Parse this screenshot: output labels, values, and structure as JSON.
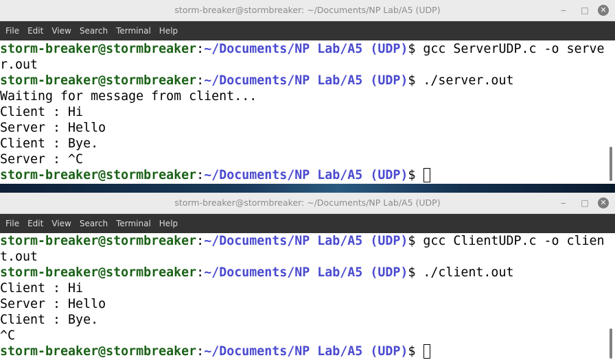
{
  "windows": [
    {
      "title": "storm-breaker@stormbreaker: ~/Documents/NP Lab/A5 (UDP)",
      "menu": [
        "File",
        "Edit",
        "View",
        "Search",
        "Terminal",
        "Help"
      ],
      "prompt_user": "storm-breaker@stormbreaker",
      "prompt_sep": ":",
      "prompt_path": "~/Documents/NP Lab/A5 (UDP)",
      "prompt_dollar": "$",
      "lines": [
        {
          "type": "prompt",
          "cmd": " gcc ServerUDP.c -o serve"
        },
        {
          "type": "text",
          "text": "r.out"
        },
        {
          "type": "prompt",
          "cmd": " ./server.out"
        },
        {
          "type": "text",
          "text": "Waiting for message from client..."
        },
        {
          "type": "text",
          "text": "Client : Hi"
        },
        {
          "type": "text",
          "text": "Server : Hello"
        },
        {
          "type": "text",
          "text": "Client : Bye."
        },
        {
          "type": "text",
          "text": "Server : ^C"
        },
        {
          "type": "prompt",
          "cmd": " ",
          "cursor": true
        }
      ]
    },
    {
      "title": "storm-breaker@stormbreaker: ~/Documents/NP Lab/A5 (UDP)",
      "menu": [
        "File",
        "Edit",
        "View",
        "Search",
        "Terminal",
        "Help"
      ],
      "prompt_user": "storm-breaker@stormbreaker",
      "prompt_sep": ":",
      "prompt_path": "~/Documents/NP Lab/A5 (UDP)",
      "prompt_dollar": "$",
      "lines": [
        {
          "type": "prompt",
          "cmd": " gcc ClientUDP.c -o clien"
        },
        {
          "type": "text",
          "text": "t.out"
        },
        {
          "type": "prompt",
          "cmd": " ./client.out"
        },
        {
          "type": "text",
          "text": "Client : Hi"
        },
        {
          "type": "text",
          "text": "Server : Hello"
        },
        {
          "type": "text",
          "text": "Client : Bye."
        },
        {
          "type": "text",
          "text": "^C"
        },
        {
          "type": "prompt",
          "cmd": " ",
          "cursor": true
        }
      ]
    }
  ],
  "window_controls": {
    "minimize": "‒",
    "maximize": "□",
    "close": "✕"
  }
}
